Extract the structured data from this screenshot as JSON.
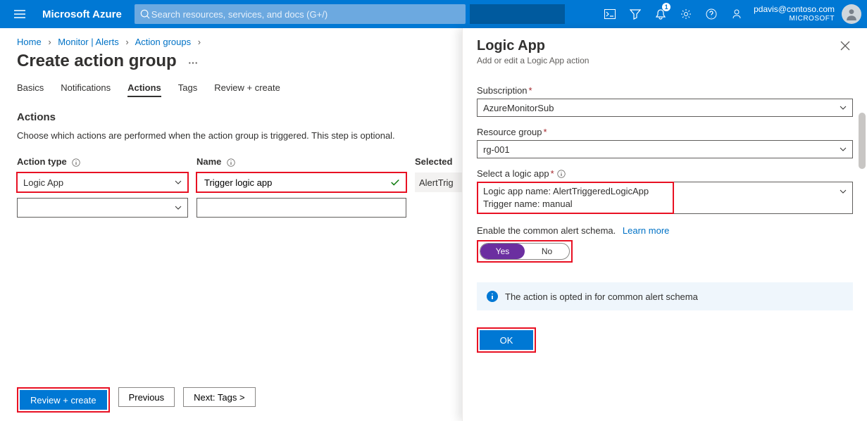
{
  "header": {
    "brand": "Microsoft Azure",
    "search_placeholder": "Search resources, services, and docs (G+/)",
    "notification_count": "1",
    "user_email": "pdavis@contoso.com",
    "directory": "MICROSOFT"
  },
  "breadcrumbs": {
    "items": [
      "Home",
      "Monitor | Alerts",
      "Action groups"
    ]
  },
  "page": {
    "title": "Create action group",
    "tabs": [
      "Basics",
      "Notifications",
      "Actions",
      "Tags",
      "Review + create"
    ],
    "active_tab": "Actions"
  },
  "actions_section": {
    "heading": "Actions",
    "description": "Choose which actions are performed when the action group is triggered. This step is optional.",
    "columns": {
      "type": "Action type",
      "name": "Name",
      "selected": "Selected"
    },
    "row1": {
      "type": "Logic App",
      "name": "Trigger logic app",
      "selected_preview": "AlertTrig"
    }
  },
  "footer": {
    "review": "Review + create",
    "previous": "Previous",
    "next": "Next: Tags >"
  },
  "panel": {
    "title": "Logic App",
    "subtitle": "Add or edit a Logic App action",
    "subscription_label": "Subscription",
    "subscription_value": "AzureMonitorSub",
    "rg_label": "Resource group",
    "rg_value": "rg-001",
    "la_label": "Select a logic app",
    "la_line1": "Logic app name: AlertTriggeredLogicApp",
    "la_line2": "Trigger name: manual",
    "schema_text": "Enable the common alert schema.",
    "learn_more": "Learn more",
    "toggle_yes": "Yes",
    "toggle_no": "No",
    "info_text": "The action is opted in for common alert schema",
    "ok": "OK"
  }
}
